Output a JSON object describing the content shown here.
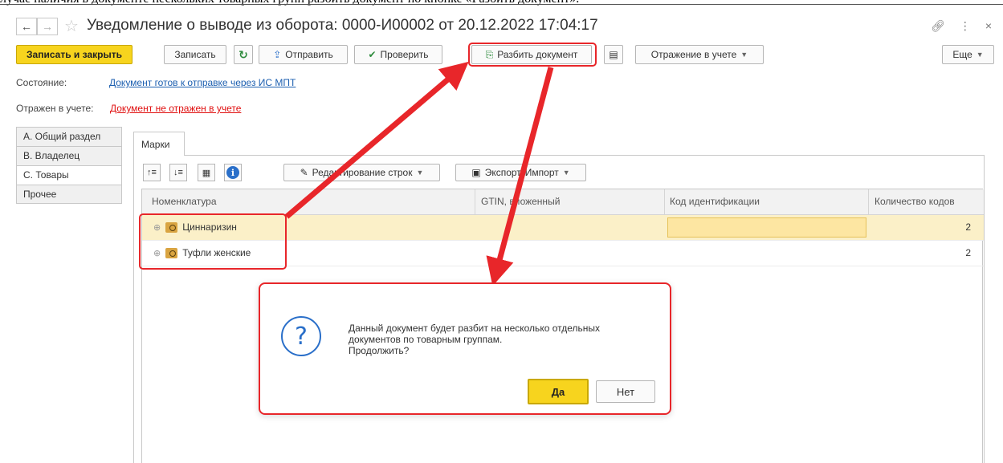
{
  "window": {
    "title": "Уведомление о выводе из оборота: 0000-И00002 от 20.12.2022 17:04:17",
    "header_cut_text": "лучае наличия в документе нескольких товарных групп разбить документ по кнопке «Разбить документ»."
  },
  "toolbar": {
    "save_close_label": "Записать и закрыть",
    "save_label": "Записать",
    "send_label": "Отправить",
    "check_label": "Проверить",
    "split_label": "Разбить документ",
    "accounting_label": "Отражение в учете",
    "more_label": "Еще"
  },
  "state": {
    "label": "Состояние:",
    "value": "Документ готов к отправке через ИС МПТ"
  },
  "accounting": {
    "label": "Отражен в учете:",
    "value": "Документ не отражен в учете"
  },
  "side_tabs": [
    {
      "label": "А. Общий раздел"
    },
    {
      "label": "В. Владелец"
    },
    {
      "label": "С. Товары"
    },
    {
      "label": "Прочее"
    }
  ],
  "panel": {
    "tab_label": "Марки",
    "edit_rows_label": "Редактирование строк",
    "export_label": "Экспорт",
    "import_label": "Импорт"
  },
  "table": {
    "columns": [
      "Номенклатура",
      "GTIN, вложенный",
      "Код идентификации",
      "Количество кодов"
    ],
    "rows": [
      {
        "name": "Циннаризин",
        "gtin": "",
        "code": "",
        "qty": "2"
      },
      {
        "name": "Туфли женские",
        "gtin": "",
        "code": "",
        "qty": "2"
      }
    ]
  },
  "dialog": {
    "line1": "Данный документ будет разбит на несколько отдельных",
    "line2": "документов по товарным группам.",
    "line3": "Продолжить?",
    "yes_label": "Да",
    "no_label": "Нет"
  },
  "colors": {
    "accent_yellow": "#f7d41e",
    "annotation_red": "#e8262a",
    "link_blue": "#1c5fb0",
    "error_red": "#e01010"
  }
}
